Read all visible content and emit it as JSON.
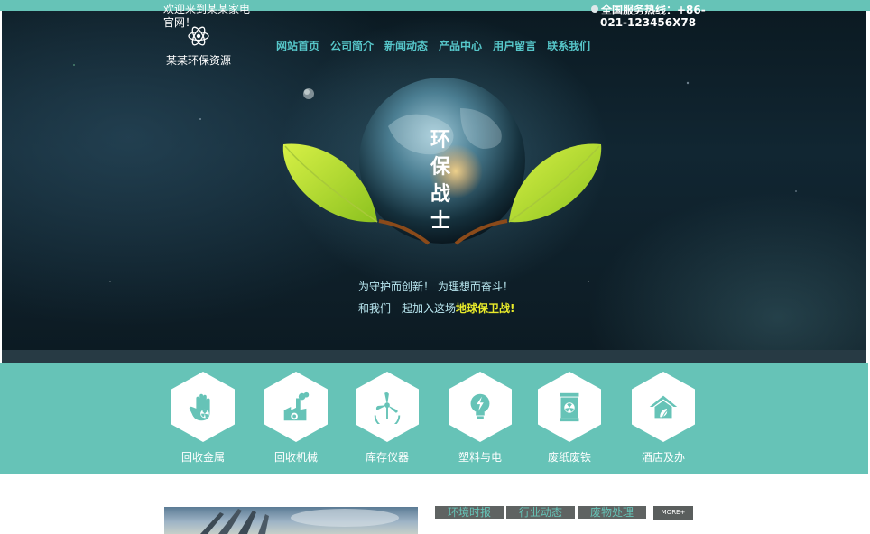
{
  "header": {
    "welcome": "欢迎来到某某家电官网！",
    "logo_text": "某某环保资源",
    "logo_icon": "atom-icon",
    "hotline_label": "全国服务热线：+86-",
    "hotline_number": "021-123456X78"
  },
  "nav": {
    "items": [
      {
        "label": "网站首页"
      },
      {
        "label": "公司简介"
      },
      {
        "label": "新闻动态"
      },
      {
        "label": "产品中心"
      },
      {
        "label": "用户留言"
      },
      {
        "label": "联系我们"
      }
    ]
  },
  "hero": {
    "slogan": [
      "环",
      "保",
      "战",
      "士"
    ],
    "tagline_line1": "为守护而创新！ 为理想而奋斗！",
    "tagline_line2_prefix": "和我们一起加入这场",
    "tagline_line2_highlight": "地球保卫战!"
  },
  "categories": [
    {
      "label": "回收金属",
      "icon": "hand-radiation-icon"
    },
    {
      "label": "回收机械",
      "icon": "factory-icon"
    },
    {
      "label": "库存仪器",
      "icon": "wind-turbine-icon"
    },
    {
      "label": "塑料与电",
      "icon": "lightbulb-icon"
    },
    {
      "label": "废纸废铁",
      "icon": "toxic-barrel-icon"
    },
    {
      "label": "酒店及办",
      "icon": "eco-house-icon"
    }
  ],
  "news": {
    "tabs": [
      {
        "label": "环境时报"
      },
      {
        "label": "行业动态"
      },
      {
        "label": "废物处理"
      }
    ],
    "more_label": "MORE+"
  },
  "colors": {
    "accent": "#66c3b7",
    "nav_text": "#56c6c9",
    "highlight": "#e8ea2a",
    "tab_bg": "#5f6362"
  }
}
